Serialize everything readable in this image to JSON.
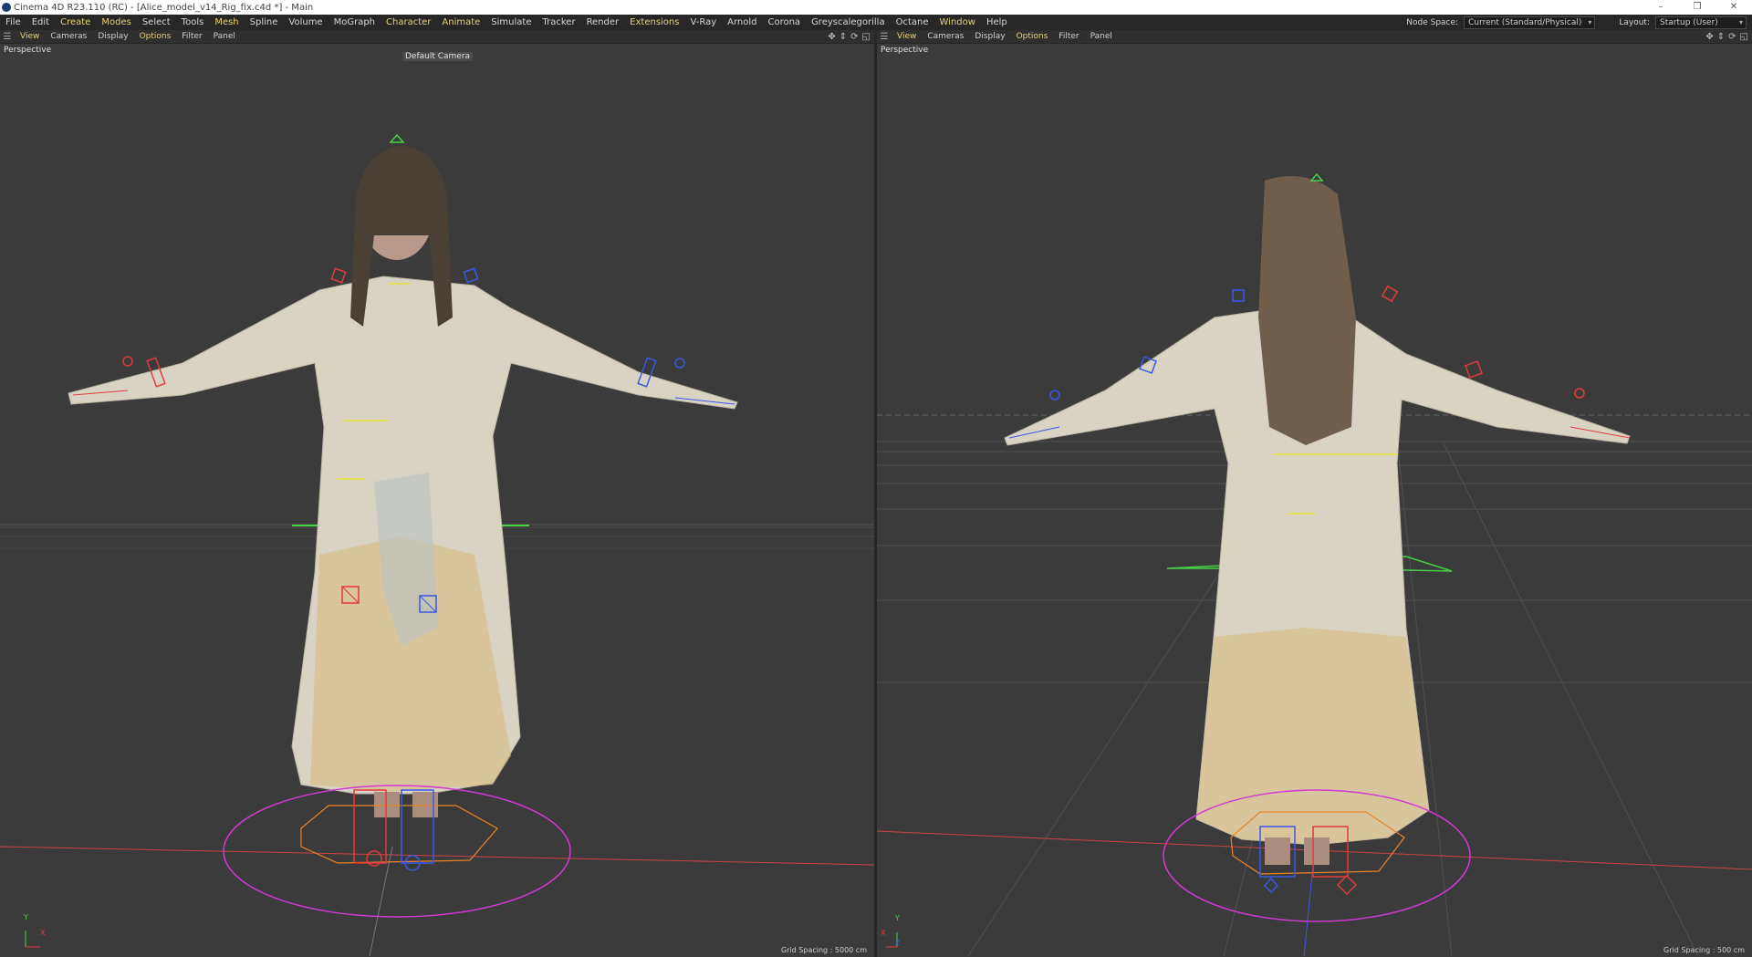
{
  "window": {
    "title": "Cinema 4D R23.110 (RC) - [Alice_model_v14_Rig_fix.c4d *] - Main",
    "controls": [
      "–",
      "❐",
      "✕"
    ]
  },
  "menubar": {
    "items": [
      {
        "label": "File",
        "highlight": false
      },
      {
        "label": "Edit",
        "highlight": false
      },
      {
        "label": "Create",
        "highlight": true
      },
      {
        "label": "Modes",
        "highlight": true
      },
      {
        "label": "Select",
        "highlight": false
      },
      {
        "label": "Tools",
        "highlight": false
      },
      {
        "label": "Mesh",
        "highlight": true
      },
      {
        "label": "Spline",
        "highlight": false
      },
      {
        "label": "Volume",
        "highlight": false
      },
      {
        "label": "MoGraph",
        "highlight": false
      },
      {
        "label": "Character",
        "highlight": true
      },
      {
        "label": "Animate",
        "highlight": true
      },
      {
        "label": "Simulate",
        "highlight": false
      },
      {
        "label": "Tracker",
        "highlight": false
      },
      {
        "label": "Render",
        "highlight": false
      },
      {
        "label": "Extensions",
        "highlight": true
      },
      {
        "label": "V-Ray",
        "highlight": false
      },
      {
        "label": "Arnold",
        "highlight": false
      },
      {
        "label": "Corona",
        "highlight": false
      },
      {
        "label": "Greyscalegorilla",
        "highlight": false
      },
      {
        "label": "Octane",
        "highlight": false
      },
      {
        "label": "Window",
        "highlight": true
      },
      {
        "label": "Help",
        "highlight": false
      }
    ],
    "node_space_label": "Node Space:",
    "node_space_value": "Current (Standard/Physical)",
    "layout_label": "Layout:",
    "layout_value": "Startup (User)"
  },
  "viewports": {
    "left": {
      "menu": [
        {
          "label": "View",
          "highlight": true
        },
        {
          "label": "Cameras",
          "highlight": false
        },
        {
          "label": "Display",
          "highlight": false
        },
        {
          "label": "Options",
          "highlight": true
        },
        {
          "label": "Filter",
          "highlight": false
        },
        {
          "label": "Panel",
          "highlight": false
        }
      ],
      "projection": "Perspective",
      "camera": "Default Camera",
      "grid_spacing": "Grid Spacing : 5000 cm",
      "axis_labels": {
        "y": "Y",
        "x": "X"
      }
    },
    "right": {
      "menu": [
        {
          "label": "View",
          "highlight": true
        },
        {
          "label": "Cameras",
          "highlight": false
        },
        {
          "label": "Display",
          "highlight": false
        },
        {
          "label": "Options",
          "highlight": true
        },
        {
          "label": "Filter",
          "highlight": false
        },
        {
          "label": "Panel",
          "highlight": false
        }
      ],
      "projection": "Perspective",
      "grid_spacing": "Grid Spacing : 500 cm",
      "axis_labels": {
        "y": "Y",
        "x": "X",
        "z": "Z"
      }
    }
  },
  "icons": {
    "app": "cinema4d-logo-icon",
    "viewport_menu": "hamburger-icon",
    "nav": [
      "move-view-icon",
      "dolly-view-icon",
      "rotate-view-icon",
      "toggle-view-icon"
    ]
  },
  "colors": {
    "menu_highlight": "#e6d07a",
    "rig_red": "#e23a3a",
    "rig_blue": "#3a57e6",
    "rig_green": "#46d246",
    "rig_magenta": "#d23ad2",
    "rig_orange": "#e8842a",
    "rig_yellow": "#e6e23a"
  }
}
